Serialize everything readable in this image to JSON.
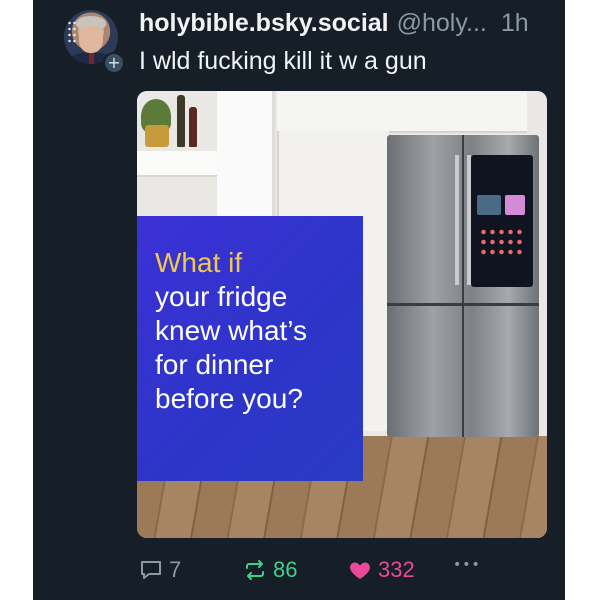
{
  "post": {
    "display_name": "holybible.bsky.social",
    "handle": "@holy...",
    "time": "1h",
    "text": "I wld fucking kill it w a gun",
    "follow_badge": "+",
    "media": {
      "promo_accent": "What if",
      "promo_rest": "your fridge\nknew what’s\nfor dinner\nbefore you?"
    },
    "actions": {
      "reply_count": "7",
      "repost_count": "86",
      "like_count": "332",
      "more_label": "•••"
    }
  },
  "colors": {
    "background": "#161e27",
    "text": "#f1f3f5",
    "muted": "#8b98a6",
    "repost_active": "#3fd18a",
    "like_active": "#ec4899",
    "promo_bg": "#3c31d6",
    "promo_accent": "#f1c84a"
  },
  "icons": {
    "reply": "reply-bubble-icon",
    "repost": "repost-icon",
    "like": "heart-icon",
    "more": "more-dots-icon"
  }
}
